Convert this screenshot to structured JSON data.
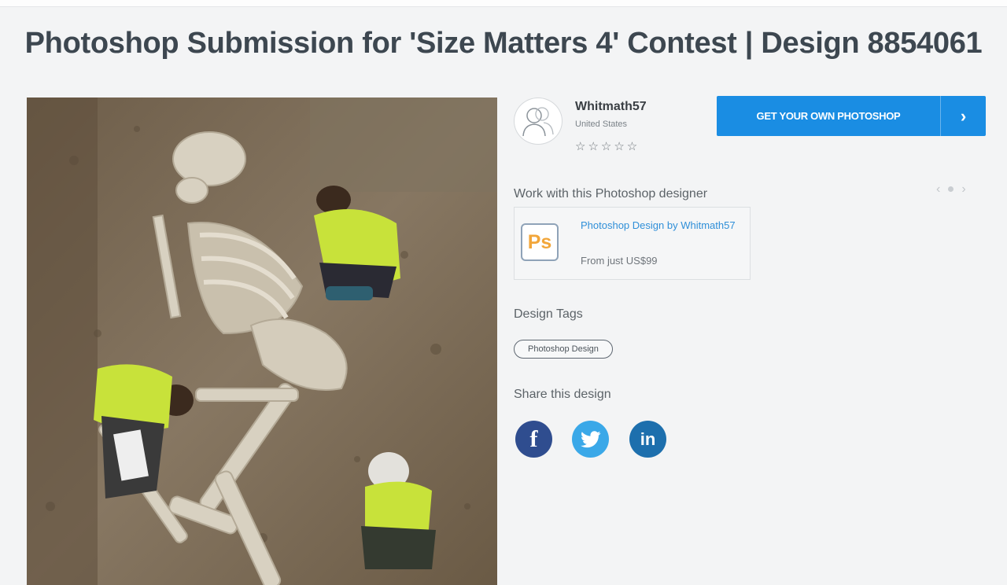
{
  "page": {
    "title": "Photoshop Submission for 'Size Matters 4' Contest | Design 8854061"
  },
  "designer": {
    "avatar_icon": "user-silhouette-icon",
    "name": "Whitmath57",
    "country": "United States",
    "rating_stars": "☆☆☆☆☆",
    "rating": 0
  },
  "cta": {
    "label": "GET YOUR OWN PHOTOSHOP",
    "arrow_icon": "chevron-right-icon",
    "color": "#1a8de3"
  },
  "carousel": {
    "prev_icon": "chevron-left-icon",
    "next_icon": "chevron-right-icon"
  },
  "work": {
    "heading": "Work with this Photoshop designer",
    "icon_text": "Ps",
    "link_label": "Photoshop Design by Whitmath57",
    "price": "From just US$99"
  },
  "tags": {
    "heading": "Design Tags",
    "items": [
      "Photoshop Design"
    ]
  },
  "share": {
    "heading": "Share this design",
    "facebook_glyph": "f",
    "linkedin_glyph": "in",
    "colors": {
      "facebook": "#2f4d8f",
      "twitter": "#3aa8e8",
      "linkedin": "#1d6fad"
    }
  }
}
